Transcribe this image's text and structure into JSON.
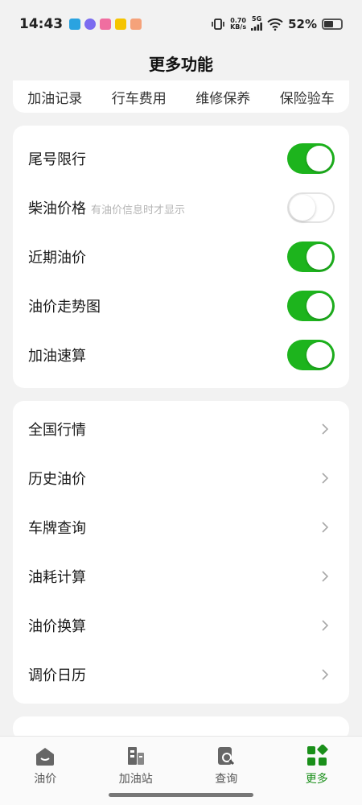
{
  "status": {
    "time": "14:43",
    "net_speed_value": "0.70",
    "net_speed_unit": "KB/s",
    "network": "5G",
    "battery": "52%"
  },
  "header": {
    "title": "更多功能"
  },
  "top_tabs": [
    "加油记录",
    "行车费用",
    "维修保养",
    "保险验车"
  ],
  "switches": [
    {
      "label": "尾号限行",
      "hint": "",
      "on": true
    },
    {
      "label": "柴油价格",
      "hint": "有油价信息时才显示",
      "on": false
    },
    {
      "label": "近期油价",
      "hint": "",
      "on": true
    },
    {
      "label": "油价走势图",
      "hint": "",
      "on": true
    },
    {
      "label": "加油速算",
      "hint": "",
      "on": true
    }
  ],
  "nav_items": [
    "全国行情",
    "历史油价",
    "车牌查询",
    "油耗计算",
    "油价换算",
    "调价日历"
  ],
  "tabbar": [
    {
      "label": "油价",
      "icon": "home-icon",
      "active": false
    },
    {
      "label": "加油站",
      "icon": "station-icon",
      "active": false
    },
    {
      "label": "查询",
      "icon": "search-doc-icon",
      "active": false
    },
    {
      "label": "更多",
      "icon": "grid-icon",
      "active": true
    }
  ],
  "colors": {
    "accent": "#1db41d",
    "active_tab": "#1a8f1a",
    "background": "#f2f2f2"
  }
}
